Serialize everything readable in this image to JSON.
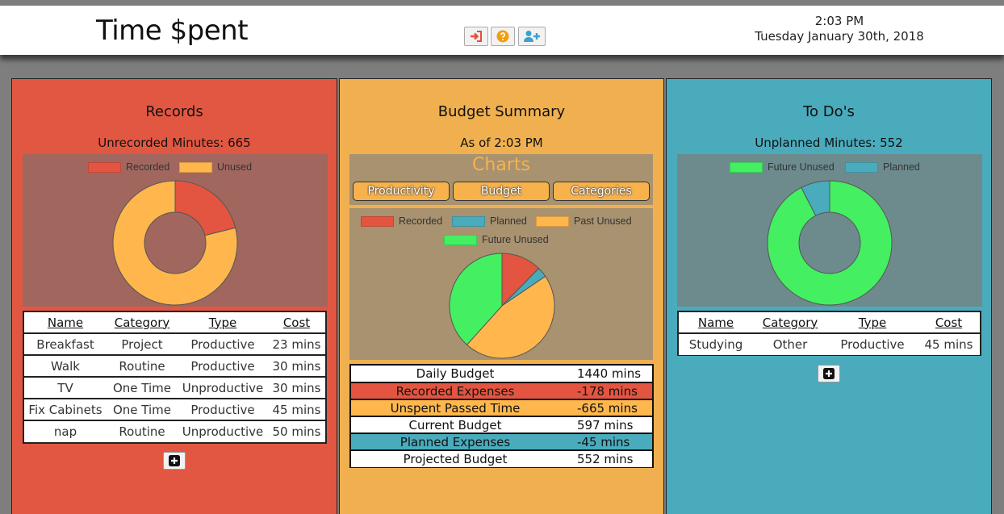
{
  "app": {
    "title": "Time $pent"
  },
  "header": {
    "time": "2:03 PM",
    "date": "Tuesday January 30th, 2018",
    "buttons": [
      {
        "icon": "sign-in-icon",
        "color": "#e74c3c"
      },
      {
        "icon": "help-icon",
        "color": "#f39c12"
      },
      {
        "icon": "add-user-icon",
        "color": "#3ba0d3"
      }
    ]
  },
  "colors": {
    "records_panel": "#e25741",
    "budget_panel": "#f0b04f",
    "todos_panel": "#4aabbc",
    "recorded": "#e35540",
    "unused": "#ffb74d",
    "planned": "#4aabbc",
    "future_unused": "#44ef62"
  },
  "records": {
    "title": "Records",
    "subtitle": "Unrecorded Minutes: 665",
    "legend": [
      "Recorded",
      "Unused"
    ],
    "columns": [
      "Name",
      "Category",
      "Type",
      "Cost"
    ],
    "rows": [
      [
        "Breakfast",
        "Project",
        "Productive",
        "23 mins"
      ],
      [
        "Walk",
        "Routine",
        "Productive",
        "30 mins"
      ],
      [
        "TV",
        "One Time",
        "Unproductive",
        "30 mins"
      ],
      [
        "Fix Cabinets",
        "One Time",
        "Productive",
        "45 mins"
      ],
      [
        "nap",
        "Routine",
        "Unproductive",
        "50 mins"
      ]
    ]
  },
  "budget": {
    "title": "Budget Summary",
    "subtitle": "As of 2:03 PM",
    "charts_heading": "Charts",
    "tabs": [
      "Productivity",
      "Budget",
      "Categories"
    ],
    "legend": [
      "Recorded",
      "Planned",
      "Past Unused",
      "Future Unused"
    ],
    "summary": [
      {
        "label": "Daily Budget",
        "value": "1440 mins",
        "bg": "#ffffff"
      },
      {
        "label": "Recorded Expenses",
        "value": "-178 mins",
        "bg": "#e35540"
      },
      {
        "label": "Unspent Passed Time",
        "value": "-665 mins",
        "bg": "#ffb74d"
      },
      {
        "label": "Current Budget",
        "value": "597 mins",
        "bg": "#ffffff"
      },
      {
        "label": "Planned Expenses",
        "value": "-45 mins",
        "bg": "#4aabbc"
      },
      {
        "label": "Projected Budget",
        "value": "552 mins",
        "bg": "#ffffff"
      }
    ]
  },
  "todos": {
    "title": "To Do's",
    "subtitle": "Unplanned Minutes: 552",
    "legend": [
      "Future Unused",
      "Planned"
    ],
    "columns": [
      "Name",
      "Category",
      "Type",
      "Cost"
    ],
    "rows": [
      [
        "Studying",
        "Other",
        "Productive",
        "45 mins"
      ]
    ]
  },
  "chart_data": [
    {
      "type": "pie",
      "donut": true,
      "labels": [
        "Recorded",
        "Unused"
      ],
      "values": [
        178,
        665
      ],
      "colors": [
        "#e35540",
        "#ffb74d"
      ],
      "legend_position": "top"
    },
    {
      "type": "pie",
      "labels": [
        "Recorded",
        "Planned",
        "Past Unused",
        "Future Unused"
      ],
      "values": [
        178,
        45,
        665,
        552
      ],
      "colors": [
        "#e35540",
        "#4aabbc",
        "#ffb74d",
        "#44ef62"
      ],
      "legend_position": "top"
    },
    {
      "type": "pie",
      "donut": true,
      "labels": [
        "Future Unused",
        "Planned"
      ],
      "values": [
        552,
        45
      ],
      "colors": [
        "#44ef62",
        "#4aabbc"
      ],
      "legend_position": "top"
    }
  ]
}
